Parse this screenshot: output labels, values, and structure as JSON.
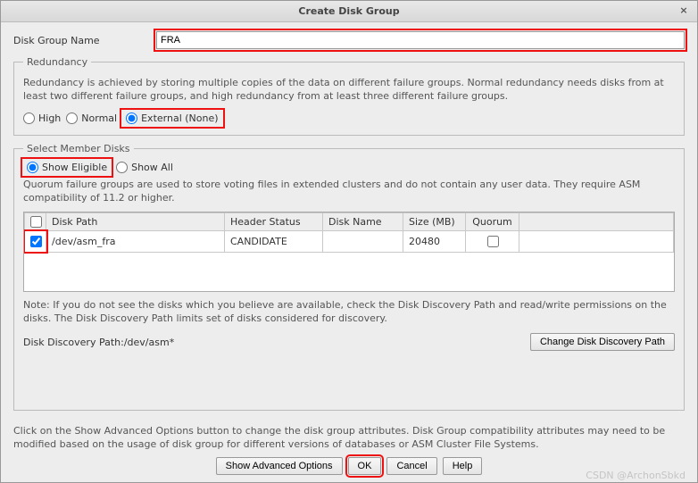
{
  "title": "Create Disk Group",
  "name_label": "Disk Group Name",
  "name_value": "FRA",
  "redundancy": {
    "legend": "Redundancy",
    "desc": "Redundancy is achieved by storing multiple copies of the data on different failure groups. Normal redundancy needs disks from at least two different failure groups, and high redundancy from at least three different failure groups.",
    "high": "High",
    "normal": "Normal",
    "external": "External (None)"
  },
  "members": {
    "legend": "Select Member Disks",
    "show_eligible": "Show Eligible",
    "show_all": "Show All",
    "desc": "Quorum failure groups are used to store voting files in extended clusters and do not contain any user data. They require ASM compatibility of 11.2 or higher.",
    "cols": {
      "path": "Disk Path",
      "header": "Header Status",
      "name": "Disk Name",
      "size": "Size (MB)",
      "quorum": "Quorum"
    },
    "rows": [
      {
        "path": "/dev/asm_fra",
        "header": "CANDIDATE",
        "name": "",
        "size": "20480",
        "quorum": false,
        "checked": true
      }
    ],
    "note": "Note: If you do not see the disks which you believe are available, check the Disk Discovery Path and read/write permissions on the disks. The Disk Discovery Path limits set of disks considered for discovery.",
    "discovery_label": "Disk Discovery Path:",
    "discovery_value": "/dev/asm*",
    "change_path_btn": "Change Disk Discovery Path"
  },
  "footer_text": "Click on the Show Advanced Options button to change the disk group attributes. Disk Group compatibility attributes may need to be modified based on the usage of disk group for different versions of databases or ASM Cluster File Systems.",
  "buttons": {
    "advanced": "Show Advanced Options",
    "ok": "OK",
    "cancel": "Cancel",
    "help": "Help"
  },
  "watermark": "CSDN @ArchonSbkd"
}
